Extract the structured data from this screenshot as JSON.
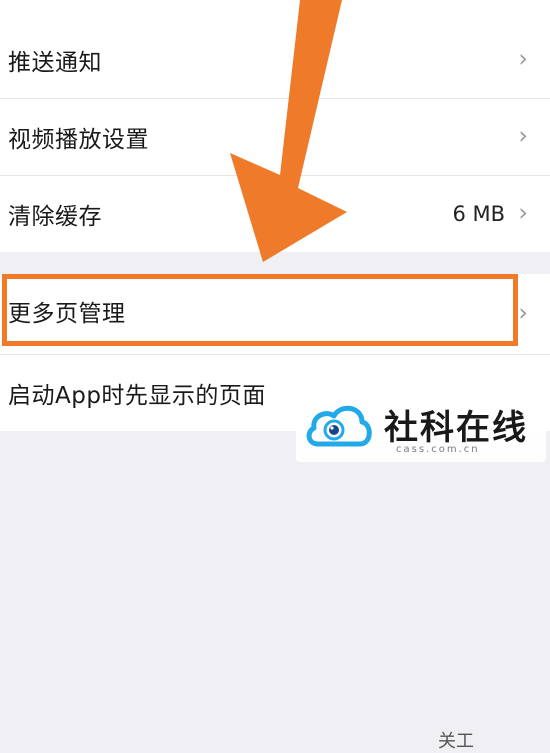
{
  "settings": {
    "items": [
      {
        "label": "推送通知",
        "value": "",
        "chevron": "›"
      },
      {
        "label": "视频播放设置",
        "value": "",
        "chevron": "›"
      },
      {
        "label": "清除缓存",
        "value": "6 MB",
        "chevron": "›"
      },
      {
        "label": "更多页管理",
        "value": "",
        "chevron": "›"
      },
      {
        "label": "启动App时先显示的页面",
        "value": "",
        "chevron": ""
      }
    ],
    "partial_value": "关工"
  },
  "annotation": {
    "arrow_color": "#ee7a2a",
    "highlight_color": "#ee7a2a",
    "highlighted_item": "更多页管理"
  },
  "watermark": {
    "name": "社科在线",
    "domain": "cass.com.cn",
    "logo_colors": [
      "#19a7e9",
      "#0e3f8a"
    ]
  }
}
